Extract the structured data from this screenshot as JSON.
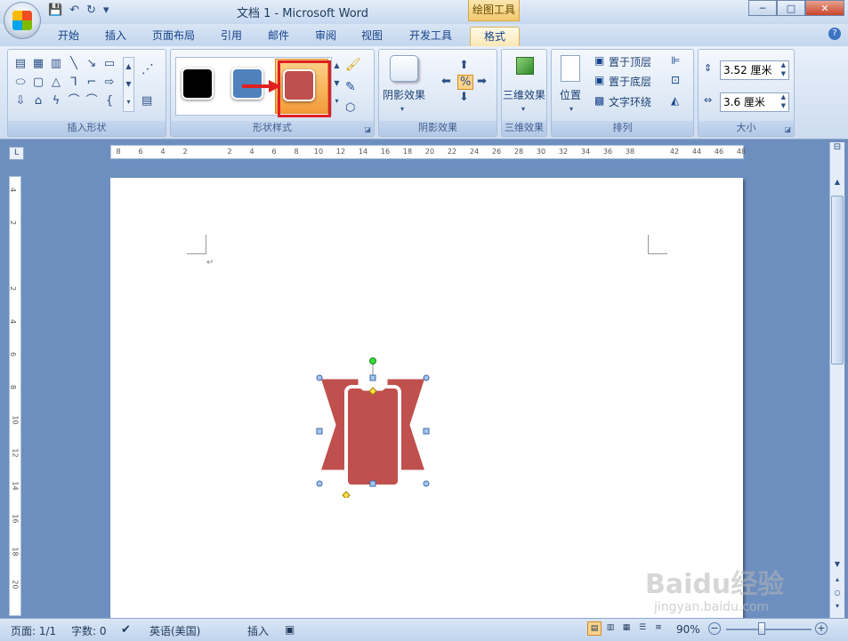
{
  "titlebar": {
    "title": "文档 1 - Microsoft Word",
    "context_tab": "绘图工具"
  },
  "tabs": [
    {
      "label": "开始"
    },
    {
      "label": "插入"
    },
    {
      "label": "页面布局"
    },
    {
      "label": "引用"
    },
    {
      "label": "邮件"
    },
    {
      "label": "审阅"
    },
    {
      "label": "视图"
    },
    {
      "label": "开发工具"
    },
    {
      "label": "格式",
      "active": true
    }
  ],
  "ribbon": {
    "groups": {
      "insert_shapes": "插入形状",
      "shape_styles": "形状样式",
      "shadow_effects": "阴影效果",
      "three_d": "三维效果",
      "arrange": "排列",
      "size": "大小"
    },
    "shadow_effects_button": "阴影效果",
    "three_d_button": "三维效果",
    "position_button": "位置",
    "bring_to_front": "置于顶层",
    "send_to_back": "置于底层",
    "text_wrap": "文字环绕",
    "height_value": "3.52 厘米",
    "width_value": "3.6 厘米",
    "style_colors": [
      "#000000",
      "#4f81bd",
      "#c0504d"
    ]
  },
  "ruler_h": [
    "8",
    "6",
    "4",
    "2",
    "",
    "2",
    "4",
    "6",
    "8",
    "10",
    "12",
    "14",
    "16",
    "18",
    "20",
    "22",
    "24",
    "26",
    "28",
    "30",
    "32",
    "34",
    "36",
    "38",
    "",
    "42",
    "44",
    "46",
    "48"
  ],
  "ruler_v": [
    "4",
    "2",
    "",
    "2",
    "4",
    "6",
    "8",
    "10",
    "12",
    "14",
    "16",
    "18",
    "20"
  ],
  "shape_fill": "#c0504d",
  "statusbar": {
    "page": "页面: 1/1",
    "words": "字数: 0",
    "language": "英语(美国)",
    "mode": "插入",
    "zoom": "90%"
  },
  "watermark": {
    "brand": "Baidu经验",
    "url": "jingyan.baidu.com"
  }
}
